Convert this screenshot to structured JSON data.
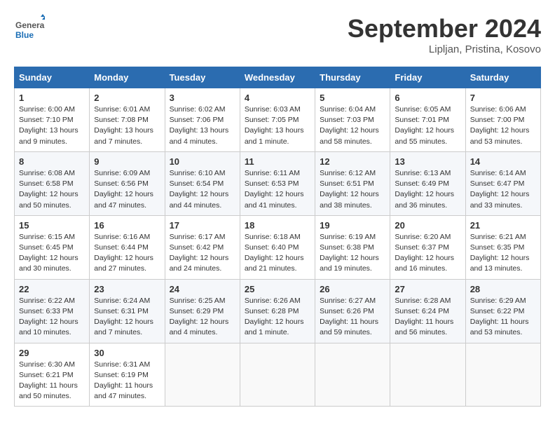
{
  "header": {
    "logo_general": "General",
    "logo_blue": "Blue",
    "month_title": "September 2024",
    "subtitle": "Lipljan, Pristina, Kosovo"
  },
  "weekdays": [
    "Sunday",
    "Monday",
    "Tuesday",
    "Wednesday",
    "Thursday",
    "Friday",
    "Saturday"
  ],
  "weeks": [
    [
      {
        "day": "1",
        "sunrise": "6:00 AM",
        "sunset": "7:10 PM",
        "daylight": "13 hours and 9 minutes."
      },
      {
        "day": "2",
        "sunrise": "6:01 AM",
        "sunset": "7:08 PM",
        "daylight": "13 hours and 7 minutes."
      },
      {
        "day": "3",
        "sunrise": "6:02 AM",
        "sunset": "7:06 PM",
        "daylight": "13 hours and 4 minutes."
      },
      {
        "day": "4",
        "sunrise": "6:03 AM",
        "sunset": "7:05 PM",
        "daylight": "13 hours and 1 minute."
      },
      {
        "day": "5",
        "sunrise": "6:04 AM",
        "sunset": "7:03 PM",
        "daylight": "12 hours and 58 minutes."
      },
      {
        "day": "6",
        "sunrise": "6:05 AM",
        "sunset": "7:01 PM",
        "daylight": "12 hours and 55 minutes."
      },
      {
        "day": "7",
        "sunrise": "6:06 AM",
        "sunset": "7:00 PM",
        "daylight": "12 hours and 53 minutes."
      }
    ],
    [
      {
        "day": "8",
        "sunrise": "6:08 AM",
        "sunset": "6:58 PM",
        "daylight": "12 hours and 50 minutes."
      },
      {
        "day": "9",
        "sunrise": "6:09 AM",
        "sunset": "6:56 PM",
        "daylight": "12 hours and 47 minutes."
      },
      {
        "day": "10",
        "sunrise": "6:10 AM",
        "sunset": "6:54 PM",
        "daylight": "12 hours and 44 minutes."
      },
      {
        "day": "11",
        "sunrise": "6:11 AM",
        "sunset": "6:53 PM",
        "daylight": "12 hours and 41 minutes."
      },
      {
        "day": "12",
        "sunrise": "6:12 AM",
        "sunset": "6:51 PM",
        "daylight": "12 hours and 38 minutes."
      },
      {
        "day": "13",
        "sunrise": "6:13 AM",
        "sunset": "6:49 PM",
        "daylight": "12 hours and 36 minutes."
      },
      {
        "day": "14",
        "sunrise": "6:14 AM",
        "sunset": "6:47 PM",
        "daylight": "12 hours and 33 minutes."
      }
    ],
    [
      {
        "day": "15",
        "sunrise": "6:15 AM",
        "sunset": "6:45 PM",
        "daylight": "12 hours and 30 minutes."
      },
      {
        "day": "16",
        "sunrise": "6:16 AM",
        "sunset": "6:44 PM",
        "daylight": "12 hours and 27 minutes."
      },
      {
        "day": "17",
        "sunrise": "6:17 AM",
        "sunset": "6:42 PM",
        "daylight": "12 hours and 24 minutes."
      },
      {
        "day": "18",
        "sunrise": "6:18 AM",
        "sunset": "6:40 PM",
        "daylight": "12 hours and 21 minutes."
      },
      {
        "day": "19",
        "sunrise": "6:19 AM",
        "sunset": "6:38 PM",
        "daylight": "12 hours and 19 minutes."
      },
      {
        "day": "20",
        "sunrise": "6:20 AM",
        "sunset": "6:37 PM",
        "daylight": "12 hours and 16 minutes."
      },
      {
        "day": "21",
        "sunrise": "6:21 AM",
        "sunset": "6:35 PM",
        "daylight": "12 hours and 13 minutes."
      }
    ],
    [
      {
        "day": "22",
        "sunrise": "6:22 AM",
        "sunset": "6:33 PM",
        "daylight": "12 hours and 10 minutes."
      },
      {
        "day": "23",
        "sunrise": "6:24 AM",
        "sunset": "6:31 PM",
        "daylight": "12 hours and 7 minutes."
      },
      {
        "day": "24",
        "sunrise": "6:25 AM",
        "sunset": "6:29 PM",
        "daylight": "12 hours and 4 minutes."
      },
      {
        "day": "25",
        "sunrise": "6:26 AM",
        "sunset": "6:28 PM",
        "daylight": "12 hours and 1 minute."
      },
      {
        "day": "26",
        "sunrise": "6:27 AM",
        "sunset": "6:26 PM",
        "daylight": "11 hours and 59 minutes."
      },
      {
        "day": "27",
        "sunrise": "6:28 AM",
        "sunset": "6:24 PM",
        "daylight": "11 hours and 56 minutes."
      },
      {
        "day": "28",
        "sunrise": "6:29 AM",
        "sunset": "6:22 PM",
        "daylight": "11 hours and 53 minutes."
      }
    ],
    [
      {
        "day": "29",
        "sunrise": "6:30 AM",
        "sunset": "6:21 PM",
        "daylight": "11 hours and 50 minutes."
      },
      {
        "day": "30",
        "sunrise": "6:31 AM",
        "sunset": "6:19 PM",
        "daylight": "11 hours and 47 minutes."
      },
      null,
      null,
      null,
      null,
      null
    ]
  ]
}
